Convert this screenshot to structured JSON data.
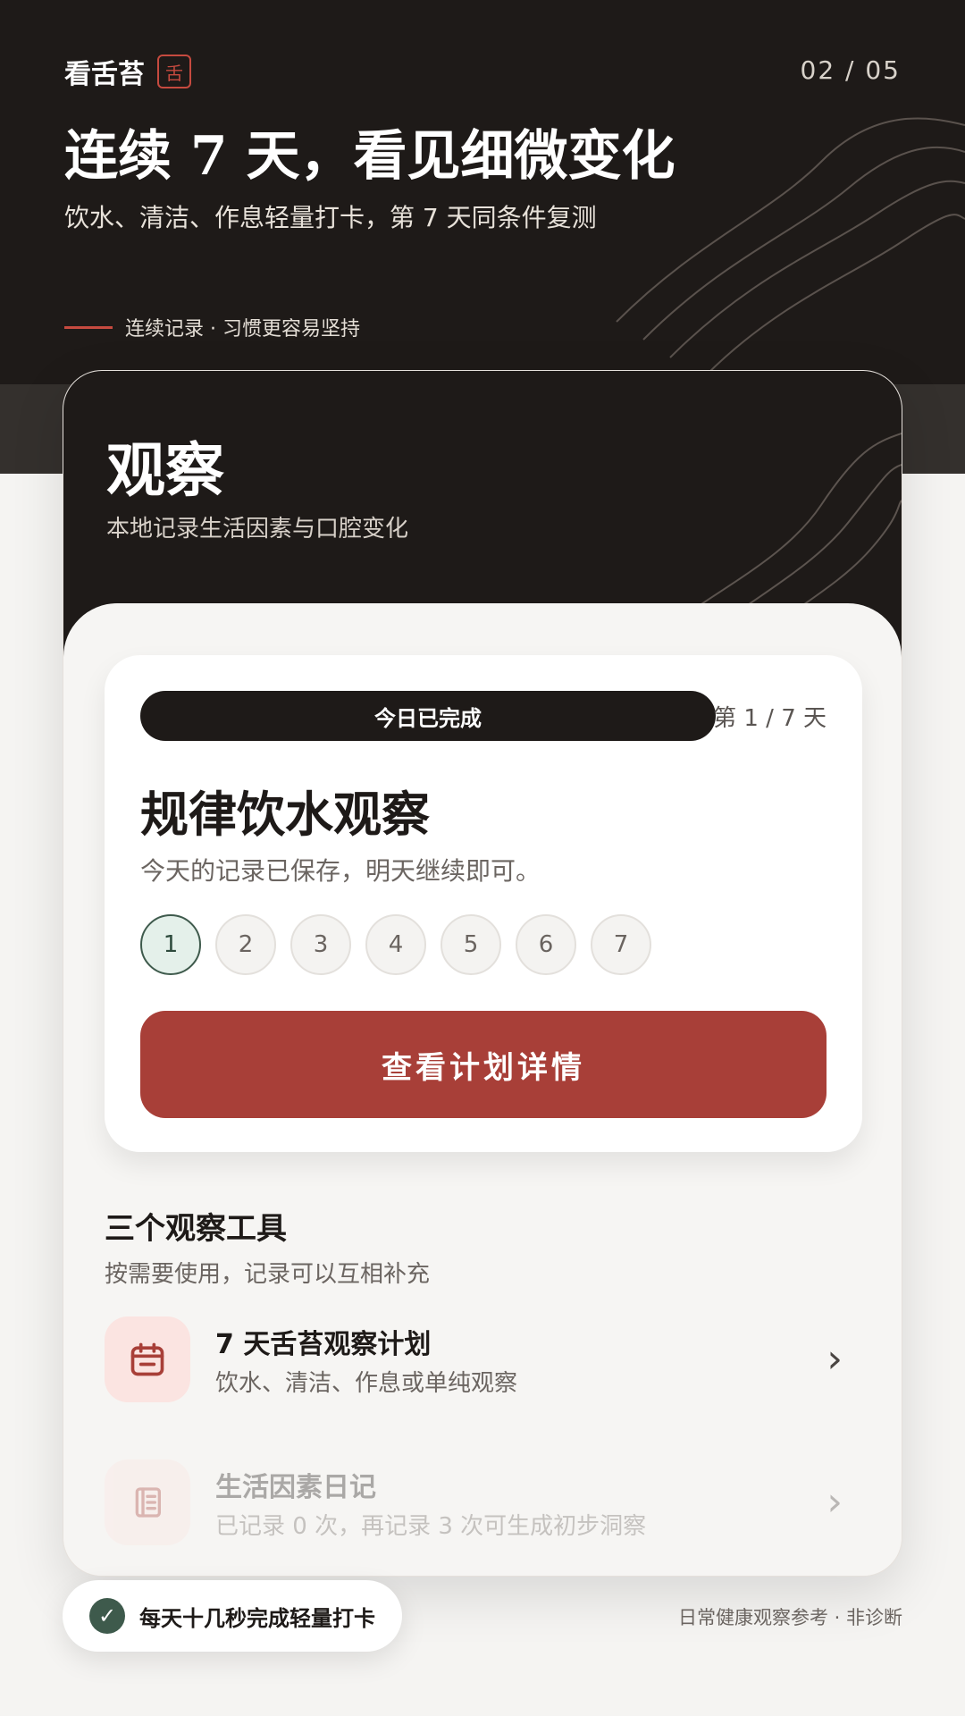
{
  "header": {
    "brand": "看舌苔",
    "brand_seal": "舌",
    "page_counter": "02 / 05",
    "headline": "连续 7 天，看见细微变化",
    "subline": "饮水、清洁、作息轻量打卡，第 7 天同条件复测",
    "tagline": "连续记录 · 习惯更容易坚持"
  },
  "screen": {
    "title": "观察",
    "subtitle": "本地记录生活因素与口腔变化"
  },
  "plan_card": {
    "status_pill": "今日已完成",
    "day_counter": "第 1 / 7 天",
    "title": "规律饮水观察",
    "note": "今天的记录已保存，明天继续即可。",
    "days": [
      "1",
      "2",
      "3",
      "4",
      "5",
      "6",
      "7"
    ],
    "current_day": 1,
    "cta_label": "查看计划详情"
  },
  "tools": {
    "title": "三个观察工具",
    "subtitle": "按需要使用，记录可以互相补充",
    "items": [
      {
        "title": "7 天舌苔观察计划",
        "desc": "饮水、清洁、作息或单纯观察",
        "icon": "calendar-icon"
      },
      {
        "title": "生活因素日记",
        "desc": "已记录 0 次，再记录 3 次可生成初步洞察",
        "icon": "notebook-icon"
      }
    ]
  },
  "footer": {
    "badge": "每天十几秒完成轻量打卡",
    "disclaimer": "日常健康观察参考 · 非诊断"
  },
  "colors": {
    "dark": "#1e1a18",
    "accent_red": "#a83f38",
    "seal_red": "#c64a3f",
    "green": "#3e5a4c",
    "icon_bg": "#fbe4e1"
  }
}
